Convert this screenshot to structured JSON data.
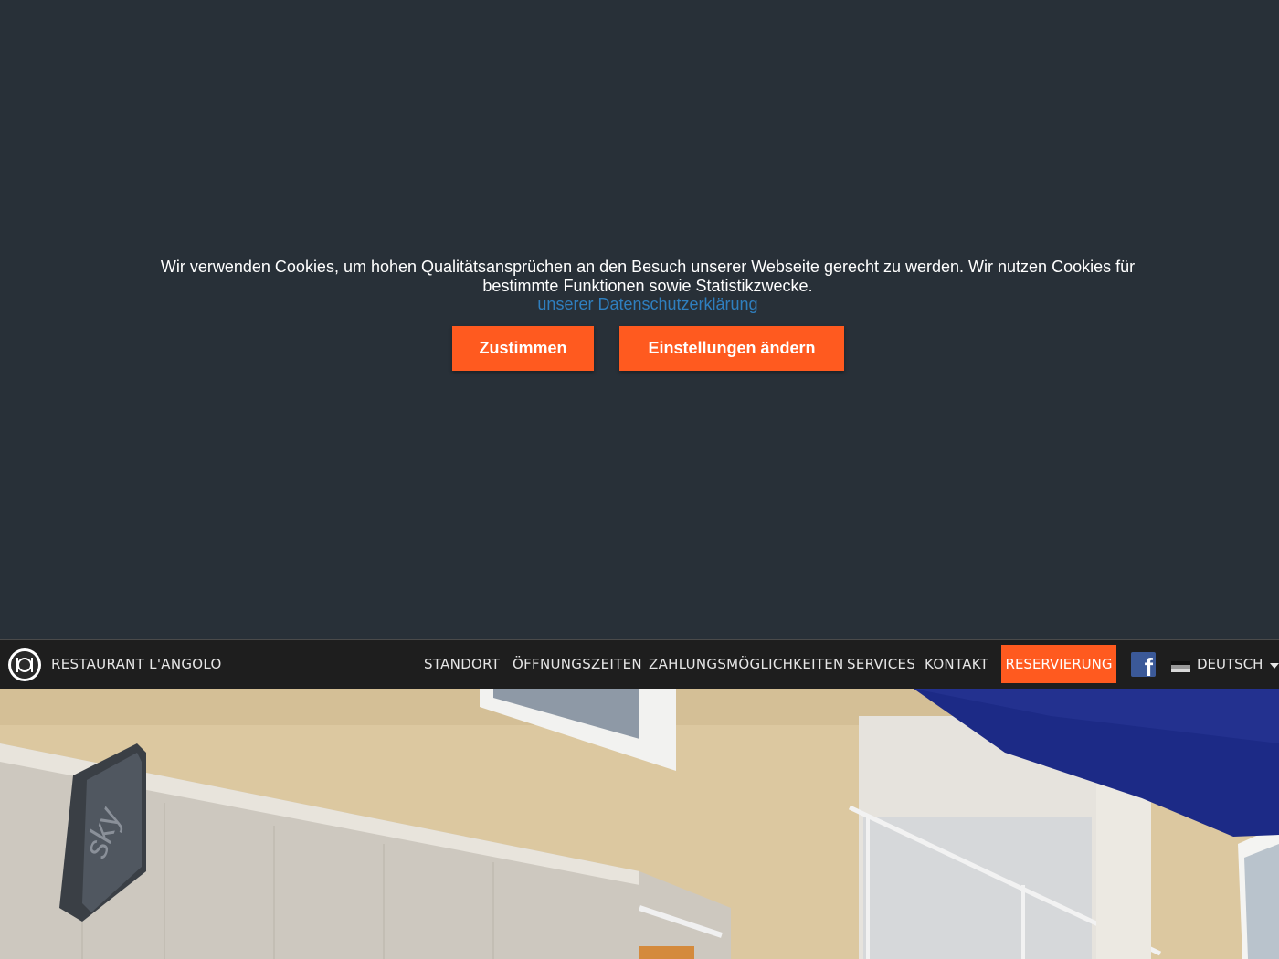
{
  "cookie": {
    "message": "Wir verwenden Cookies, um hohen Qualitätsansprüchen an den Besuch unserer Webseite gerecht zu werden. Wir nutzen Cookies für bestimmte Funktionen sowie Statistikzwecke.",
    "privacy_link": "unserer Datenschutzerklärung",
    "accept_label": "Zustimmen",
    "settings_label": "Einstellungen ändern"
  },
  "nav": {
    "brand": "RESTAURANT L'ANGOLO",
    "items": [
      "STANDORT",
      "ÖFFNUNGSZEITEN",
      "ZAHLUNGSMÖGLICHKEITEN",
      "SERVICES",
      "KONTAKT"
    ],
    "reserve_label": "RESERVIERUNG",
    "facebook_glyph": "f",
    "language": "DEUTSCH"
  },
  "hero": {
    "sign_text": "sky"
  },
  "colors": {
    "background": "#283038",
    "accent": "#ff5a1f",
    "link": "#2f7fbf",
    "navbar": "#1e1e1e",
    "facebook": "#3b5998"
  },
  "icons": {
    "logo": "plate-cutlery-icon",
    "facebook": "facebook-icon",
    "flag": "german-flag-icon",
    "caret": "caret-down-icon"
  }
}
